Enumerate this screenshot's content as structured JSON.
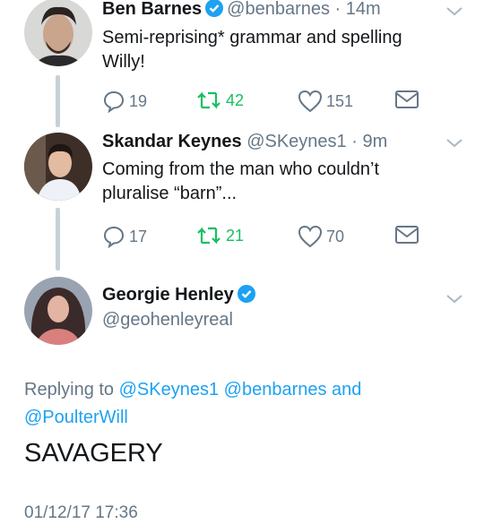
{
  "tweets": [
    {
      "name": "Ben Barnes",
      "handle": "@benbarnes",
      "time": "· 14m",
      "text_line1": "Semi-reprising* grammar and spelling",
      "text_line2": "Willy!",
      "replies": "19",
      "retweets": "42",
      "likes": "151"
    },
    {
      "name": "Skandar Keynes",
      "handle": "@SKeynes1",
      "time": "· 9m",
      "text_line1": "Coming from the man who couldn’t",
      "text_line2": "pluralise “barn”...",
      "replies": "17",
      "retweets": "21",
      "likes": "70"
    }
  ],
  "main_tweet": {
    "name": "Georgie Henley",
    "handle": "@geohenleyreal",
    "replying_prefix": "Replying to ",
    "reply_user1": "@SKeynes1",
    "reply_user2": "@benbarnes",
    "reply_and": " and",
    "reply_user3": "@PoulterWill",
    "text": "SAVAGERY",
    "timestamp": "01/12/17 17:36"
  },
  "colors": {
    "accent": "#1da1f2",
    "retweet": "#17bf63",
    "muted": "#657786"
  }
}
